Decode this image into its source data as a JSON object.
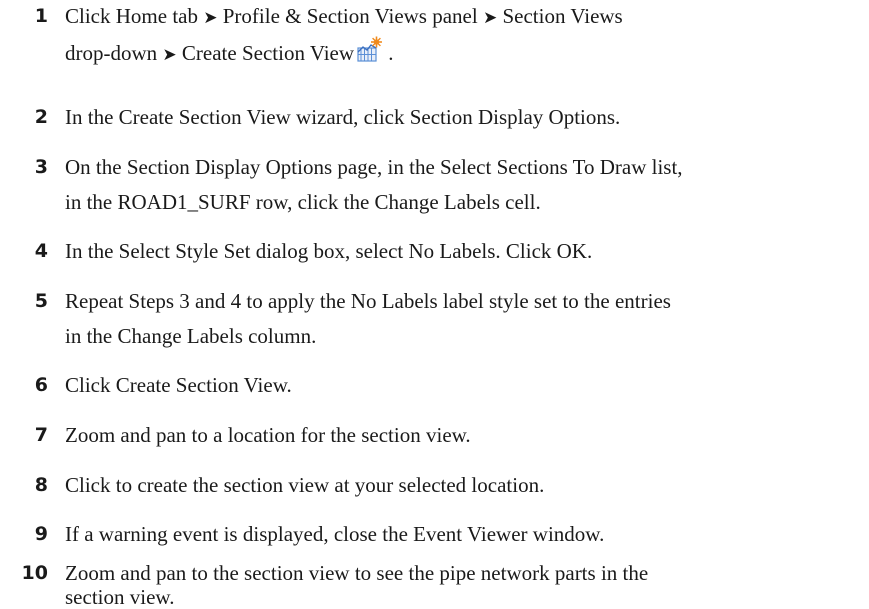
{
  "arrow_glyph": "➤",
  "steps": [
    {
      "number": "1",
      "line1_segments": [
        "Click Home tab",
        "Profile & Section Views panel",
        "Section Views"
      ],
      "line2_segments": [
        "drop-down",
        "Create Section View"
      ],
      "line2_tail": " .",
      "icon": "create-section-view-icon"
    },
    {
      "number": "2",
      "lines": [
        "In the Create Section View wizard, click Section Display Options."
      ]
    },
    {
      "number": "3",
      "lines": [
        "On the Section Display Options page, in the Select Sections To Draw list,",
        "in the ROAD1_SURF row, click the Change Labels cell."
      ]
    },
    {
      "number": "4",
      "lines": [
        "In the Select Style Set dialog box, select No Labels. Click OK."
      ]
    },
    {
      "number": "5",
      "lines": [
        "Repeat Steps 3 and 4 to apply the No Labels label style set to the entries",
        "in the Change Labels column."
      ]
    },
    {
      "number": "6",
      "lines": [
        "Click Create Section View."
      ]
    },
    {
      "number": "7",
      "lines": [
        "Zoom and pan to a location for the section view."
      ]
    },
    {
      "number": "8",
      "lines": [
        "Click to create the section view at your selected location."
      ]
    },
    {
      "number": "9",
      "lines": [
        "If a warning event is displayed, close the Event Viewer window."
      ]
    },
    {
      "number": "10",
      "lines": [
        "Zoom and pan to the section view to see the pipe network parts in the",
        "section view."
      ]
    }
  ],
  "colors": {
    "text": "#1a1a1a",
    "icon_blue": "#5b8fd6",
    "icon_orange": "#f08a1c"
  }
}
